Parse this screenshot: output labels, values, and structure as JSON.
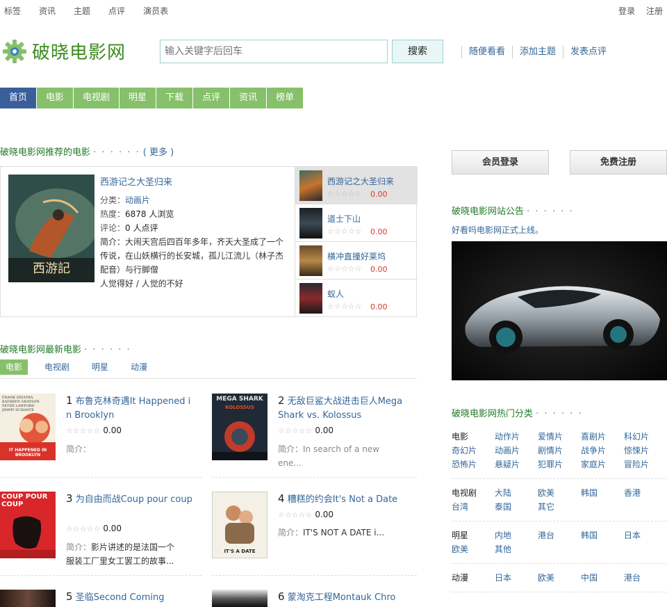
{
  "topbar": {
    "left": [
      "标签",
      "资讯",
      "主题",
      "点评",
      "演员表"
    ],
    "right": [
      "登录",
      "注册"
    ]
  },
  "header": {
    "site_name": "破晓电影网",
    "search_placeholder": "输入关键字后回车",
    "search_button": "搜索",
    "quick_links": [
      "随便看看",
      "添加主题",
      "发表点评"
    ]
  },
  "nav": {
    "items": [
      "首页",
      "电影",
      "电视剧",
      "明星",
      "下载",
      "点评",
      "资讯",
      "榜单"
    ],
    "active": "首页"
  },
  "recommend": {
    "title": "破晓电影网推荐的电影",
    "dots": "· · · · · ·",
    "more": "( 更多 )",
    "featured": {
      "title": "西游记之大圣归来",
      "poster_caption": "西游記",
      "category_label": "分类：",
      "category": "动画片",
      "hot_label": "热度：",
      "hot": "6878 人浏览",
      "comments_label": "评论：",
      "comments": "0 人点评",
      "intro_label": "简介：",
      "intro": "大闹天宫后四百年多年，齐天大圣成了一个传说，在山妖横行的长安城，孤儿江流儿（林子杰 配音）与行脚僧",
      "vote": "人觉得好 / 人觉的不好"
    },
    "list": [
      {
        "name": "西游记之大圣归来",
        "stars": "☆☆☆☆☆",
        "score": "0.00"
      },
      {
        "name": "道士下山",
        "stars": "☆☆☆☆☆",
        "score": "0.00"
      },
      {
        "name": "横冲直撞好莱坞",
        "stars": "☆☆☆☆☆",
        "score": "0.00"
      },
      {
        "name": "蚁人",
        "stars": "☆☆☆☆☆",
        "score": "0.00"
      }
    ]
  },
  "latest": {
    "title": "破晓电影网最新电影",
    "dots": "· · · · · ·",
    "tabs": [
      "电影",
      "电视剧",
      "明星",
      "动漫"
    ],
    "active_tab": "电影",
    "movies": [
      {
        "num": "1",
        "title": "布鲁克林奇遇It Happened in Brooklyn",
        "stars": "☆☆☆☆☆",
        "score": "0.00",
        "desc_label": "简介：",
        "desc": ""
      },
      {
        "num": "2",
        "title": "无敌巨鲨大战进击巨人Mega Shark vs. Kolossus",
        "stars": "☆☆☆☆☆",
        "score": "0.00",
        "desc_label": "简介：",
        "desc": "In search of a new ene..."
      },
      {
        "num": "3",
        "title": "为自由而战Coup pour coup",
        "stars": "☆☆☆☆☆",
        "score": "0.00",
        "desc_label": "简介：",
        "desc": "影片讲述的是法国一个服装工厂里女工罢工的故事..."
      },
      {
        "num": "4",
        "title": "糟糕的约会It's Not a Date",
        "stars": "☆☆☆☆☆",
        "score": "0.00",
        "desc_label": "简介：",
        "desc": "IT'S NOT A DATE i..."
      },
      {
        "num": "5",
        "title": "圣临Second Coming",
        "stars": "",
        "score": "",
        "desc_label": "",
        "desc": ""
      },
      {
        "num": "6",
        "title": "蒙淘克工程Montauk Chro",
        "stars": "",
        "score": "",
        "desc_label": "",
        "desc": ""
      }
    ],
    "posters": {
      "p1_top": "FRANK SINATRA\nKATHRYN GRAYSON\nPETER LAWFORD\nJIMMY DURANTE",
      "p1_bottom": "IT HAPPENED IN BROOKLYN",
      "p2_top": "MEGA SHARK",
      "p2_sub": "KOLOSSUS",
      "p3_top": "COUP POUR COUP",
      "p4_bottom": "IT'S A DATE"
    }
  },
  "sidebar": {
    "login_button": "会员登录",
    "register_button": "免费注册",
    "notice_title": "破晓电影网站公告",
    "notice_dots": "· · · · · ·",
    "notice_text": "好看吗电影网正式上线。",
    "categories_title": "破晓电影网热门分类",
    "categories_dots": "· · · · · ·",
    "groups": [
      {
        "head": "电影",
        "items": [
          "动作片",
          "爱情片",
          "喜剧片",
          "科幻片",
          "奇幻片",
          "动画片",
          "剧情片",
          "战争片",
          "惊悚片",
          "恐怖片",
          "悬疑片",
          "犯罪片",
          "家庭片",
          "冒险片"
        ]
      },
      {
        "head": "电视剧",
        "items": [
          "大陆",
          "欧美",
          "韩国",
          "香港",
          "台湾",
          "泰国",
          "其它"
        ]
      },
      {
        "head": "明星",
        "items": [
          "内地",
          "港台",
          "韩国",
          "日本",
          "欧美",
          "其他"
        ]
      },
      {
        "head": "动漫",
        "items": [
          "日本",
          "欧美",
          "中国",
          "港台"
        ]
      }
    ]
  },
  "colors": {
    "green_nav": "#86c06a",
    "blue_active": "#3a5e9a",
    "link_blue": "#336699",
    "title_green": "#1f7a2a",
    "score_red": "#e0352b"
  }
}
